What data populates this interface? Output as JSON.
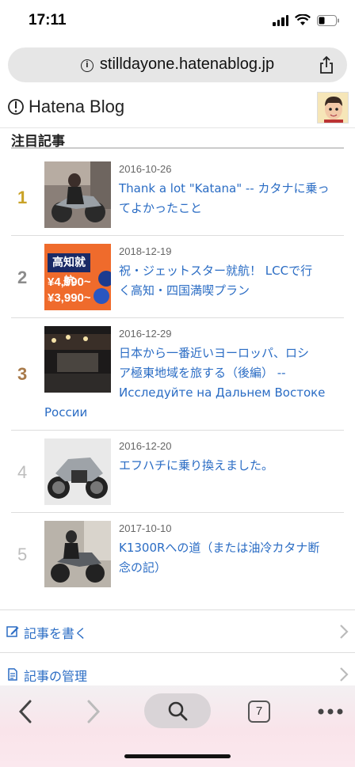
{
  "status": {
    "time": "17:11"
  },
  "browser": {
    "url": "stilldayone.hatenablog.jp",
    "tab_count": "7"
  },
  "header": {
    "logo_text": "Hatena Blog"
  },
  "section": {
    "title": "注目記事"
  },
  "articles": [
    {
      "rank": "1",
      "rank_color": "#c9a227",
      "date": "2016-10-26",
      "title_line1": "Thank a lot \"Katana\" -- カタナに乗っ",
      "title_line2": "てよかったこと",
      "title_line3": ""
    },
    {
      "rank": "2",
      "rank_color": "#8c8c8c",
      "date": "2018-12-19",
      "title_line1": "祝・ジェットスター就航！ LCCで行",
      "title_line2": "く高知・四国満喫プラン",
      "title_line3": "",
      "thumb_text": "高知就航",
      "thumb_price1": "¥4,990~",
      "thumb_price2": "¥3,990~"
    },
    {
      "rank": "3",
      "rank_color": "#a87a4a",
      "date": "2016-12-29",
      "title_line1": "日本から一番近いヨーロッパ、ロシ",
      "title_line2": "ア極東地域を旅する（後編） --",
      "title_line3": "Исследуйте на Дальнем Востоке",
      "title_line4": "России"
    },
    {
      "rank": "4",
      "rank_color": "#bdbdbd",
      "date": "2016-12-20",
      "title_line1": "エフハチに乗り換えました。",
      "title_line2": "",
      "title_line3": ""
    },
    {
      "rank": "5",
      "rank_color": "#bdbdbd",
      "date": "2017-10-10",
      "title_line1": "K1300Rへの道（または油冷カタナ断",
      "title_line2": "念の記）",
      "title_line3": ""
    }
  ],
  "menu": {
    "write_label": "記事を書く",
    "manage_label": "記事の管理"
  }
}
